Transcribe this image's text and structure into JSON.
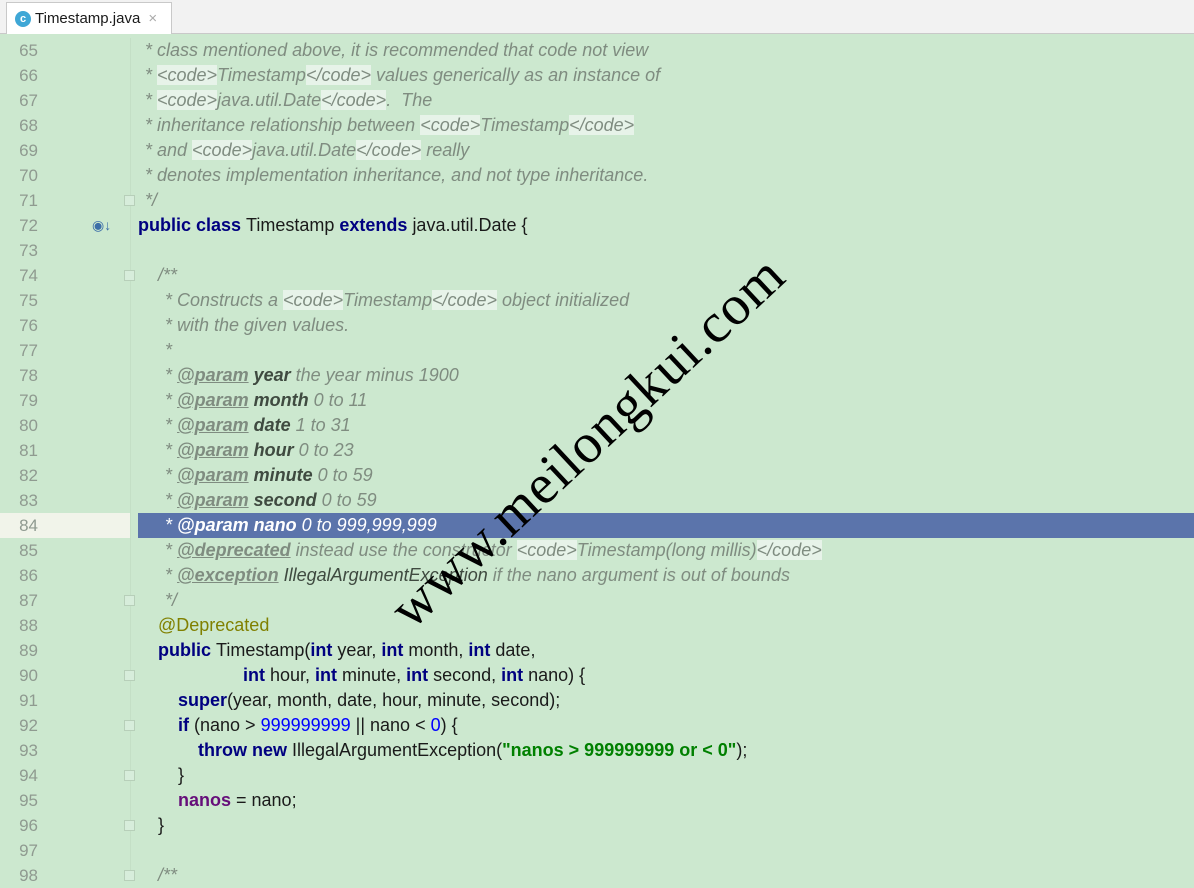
{
  "tab": {
    "icon_letter": "c",
    "title": "Timestamp.java",
    "close": "×"
  },
  "watermark": "www.meilongkui.com",
  "lines": [
    {
      "n": "65",
      "indent": 145,
      "tokens": [
        [
          "cm",
          "* class mentioned above, it is recommended that code not view"
        ]
      ]
    },
    {
      "n": "66",
      "indent": 145,
      "tokens": [
        [
          "cm",
          "* "
        ],
        [
          "tg",
          "<code>"
        ],
        [
          "cm",
          "Timestamp"
        ],
        [
          "tg",
          "</code>"
        ],
        [
          "cm",
          " values generically as an instance of"
        ]
      ]
    },
    {
      "n": "67",
      "indent": 145,
      "tokens": [
        [
          "cm",
          "* "
        ],
        [
          "tg",
          "<code>"
        ],
        [
          "cm",
          "java.util.Date"
        ],
        [
          "tg",
          "</code>"
        ],
        [
          "cm",
          ".  The"
        ]
      ]
    },
    {
      "n": "68",
      "indent": 145,
      "tokens": [
        [
          "cm",
          "* inheritance relationship between "
        ],
        [
          "tg",
          "<code>"
        ],
        [
          "cm",
          "Timestamp"
        ],
        [
          "tg",
          "</code>"
        ]
      ]
    },
    {
      "n": "69",
      "indent": 145,
      "tokens": [
        [
          "cm",
          "* and "
        ],
        [
          "tg",
          "<code>"
        ],
        [
          "cm",
          "java.util.Date"
        ],
        [
          "tg",
          "</code>"
        ],
        [
          "cm",
          " really"
        ]
      ]
    },
    {
      "n": "70",
      "indent": 145,
      "tokens": [
        [
          "cm",
          "* denotes implementation inheritance, and not type inheritance."
        ]
      ]
    },
    {
      "n": "71",
      "indent": 145,
      "fold": true,
      "tokens": [
        [
          "cm",
          "*/"
        ]
      ]
    },
    {
      "n": "72",
      "indent": 138,
      "icon": true,
      "tokens": [
        [
          "kw",
          "public class "
        ],
        [
          "id",
          "Timestamp "
        ],
        [
          "kw",
          "extends "
        ],
        [
          "id",
          "java.util.Date {"
        ]
      ]
    },
    {
      "n": "73",
      "indent": 138,
      "tokens": []
    },
    {
      "n": "74",
      "indent": 158,
      "fold": true,
      "tokens": [
        [
          "cm",
          "/**"
        ]
      ]
    },
    {
      "n": "75",
      "indent": 165,
      "tokens": [
        [
          "cm",
          "* Constructs a "
        ],
        [
          "tg",
          "<code>"
        ],
        [
          "cm",
          "Timestamp"
        ],
        [
          "tg",
          "</code>"
        ],
        [
          "cm",
          " object initialized"
        ]
      ]
    },
    {
      "n": "76",
      "indent": 165,
      "tokens": [
        [
          "cm",
          "* with the given values."
        ]
      ]
    },
    {
      "n": "77",
      "indent": 165,
      "tokens": [
        [
          "cm",
          "*"
        ]
      ]
    },
    {
      "n": "78",
      "indent": 165,
      "tokens": [
        [
          "cm",
          "* "
        ],
        [
          "dt",
          "@param"
        ],
        [
          "cm",
          " "
        ],
        [
          "pn",
          "year"
        ],
        [
          "cm",
          " the year minus 1900"
        ]
      ]
    },
    {
      "n": "79",
      "indent": 165,
      "tokens": [
        [
          "cm",
          "* "
        ],
        [
          "dt",
          "@param"
        ],
        [
          "cm",
          " "
        ],
        [
          "pn",
          "month"
        ],
        [
          "cm",
          " 0 to 11"
        ]
      ]
    },
    {
      "n": "80",
      "indent": 165,
      "tokens": [
        [
          "cm",
          "* "
        ],
        [
          "dt",
          "@param"
        ],
        [
          "cm",
          " "
        ],
        [
          "pn",
          "date"
        ],
        [
          "cm",
          " 1 to 31"
        ]
      ]
    },
    {
      "n": "81",
      "indent": 165,
      "tokens": [
        [
          "cm",
          "* "
        ],
        [
          "dt",
          "@param"
        ],
        [
          "cm",
          " "
        ],
        [
          "pn",
          "hour"
        ],
        [
          "cm",
          " 0 to 23"
        ]
      ]
    },
    {
      "n": "82",
      "indent": 165,
      "tokens": [
        [
          "cm",
          "* "
        ],
        [
          "dt",
          "@param"
        ],
        [
          "cm",
          " "
        ],
        [
          "pn",
          "minute"
        ],
        [
          "cm",
          " 0 to 59"
        ]
      ]
    },
    {
      "n": "83",
      "indent": 165,
      "tokens": [
        [
          "cm",
          "* "
        ],
        [
          "dt",
          "@param"
        ],
        [
          "cm",
          " "
        ],
        [
          "pn",
          "second"
        ],
        [
          "cm",
          " 0 to 59"
        ]
      ]
    },
    {
      "n": "84",
      "indent": 165,
      "selected": true,
      "tokens": [
        [
          "cm",
          "* "
        ],
        [
          "dt",
          "@param"
        ],
        [
          "cm",
          " "
        ],
        [
          "pn",
          "nano"
        ],
        [
          "cm",
          " 0 to 999,999,999"
        ]
      ]
    },
    {
      "n": "85",
      "indent": 165,
      "tokens": [
        [
          "cm",
          "* "
        ],
        [
          "dt",
          "@deprecated"
        ],
        [
          "cm",
          " instead use the constructor "
        ],
        [
          "tg",
          "<code>"
        ],
        [
          "cm",
          "Timestamp(long millis)"
        ],
        [
          "tg",
          "</code>"
        ]
      ]
    },
    {
      "n": "86",
      "indent": 165,
      "tokens": [
        [
          "cm",
          "* "
        ],
        [
          "dt",
          "@exception"
        ],
        [
          "cm",
          " "
        ],
        [
          "ex",
          "IllegalArgumentException"
        ],
        [
          "cm",
          " if the nano argument is out of bounds"
        ]
      ]
    },
    {
      "n": "87",
      "indent": 165,
      "fold": true,
      "tokens": [
        [
          "cm",
          "*/"
        ]
      ]
    },
    {
      "n": "88",
      "indent": 158,
      "tokens": [
        [
          "an",
          "@Deprecated"
        ]
      ]
    },
    {
      "n": "89",
      "indent": 158,
      "tokens": [
        [
          "kw",
          "public "
        ],
        [
          "id",
          "Timestamp("
        ],
        [
          "kw",
          "int "
        ],
        [
          "id",
          "year, "
        ],
        [
          "kw",
          "int "
        ],
        [
          "id",
          "month, "
        ],
        [
          "kw",
          "int "
        ],
        [
          "id",
          "date,"
        ]
      ]
    },
    {
      "n": "90",
      "indent": 243,
      "fold": true,
      "tokens": [
        [
          "kw",
          "int "
        ],
        [
          "id",
          "hour, "
        ],
        [
          "kw",
          "int "
        ],
        [
          "id",
          "minute, "
        ],
        [
          "kw",
          "int "
        ],
        [
          "id",
          "second, "
        ],
        [
          "kw",
          "int "
        ],
        [
          "id",
          "nano) {"
        ]
      ]
    },
    {
      "n": "91",
      "indent": 178,
      "tokens": [
        [
          "kw",
          "super"
        ],
        [
          "id",
          "(year, month, date, hour, minute, second);"
        ]
      ]
    },
    {
      "n": "92",
      "indent": 178,
      "fold": true,
      "tokens": [
        [
          "kw",
          "if "
        ],
        [
          "id",
          "(nano > "
        ],
        [
          "nm",
          "999999999"
        ],
        [
          "id",
          " || nano < "
        ],
        [
          "nm",
          "0"
        ],
        [
          "id",
          ") {"
        ]
      ]
    },
    {
      "n": "93",
      "indent": 198,
      "tokens": [
        [
          "kw",
          "throw new "
        ],
        [
          "id",
          "IllegalArgumentException("
        ],
        [
          "st",
          "\"nanos > 999999999 or < 0\""
        ],
        [
          "id",
          ");"
        ]
      ]
    },
    {
      "n": "94",
      "indent": 178,
      "fold": true,
      "tokens": [
        [
          "id",
          "}"
        ]
      ]
    },
    {
      "n": "95",
      "indent": 178,
      "tokens": [
        [
          "fd",
          "nanos"
        ],
        [
          "id",
          " = nano;"
        ]
      ]
    },
    {
      "n": "96",
      "indent": 158,
      "fold": true,
      "tokens": [
        [
          "id",
          "}"
        ]
      ]
    },
    {
      "n": "97",
      "indent": 138,
      "tokens": []
    },
    {
      "n": "98",
      "indent": 158,
      "fold": true,
      "tokens": [
        [
          "cm",
          "/**"
        ]
      ]
    }
  ]
}
